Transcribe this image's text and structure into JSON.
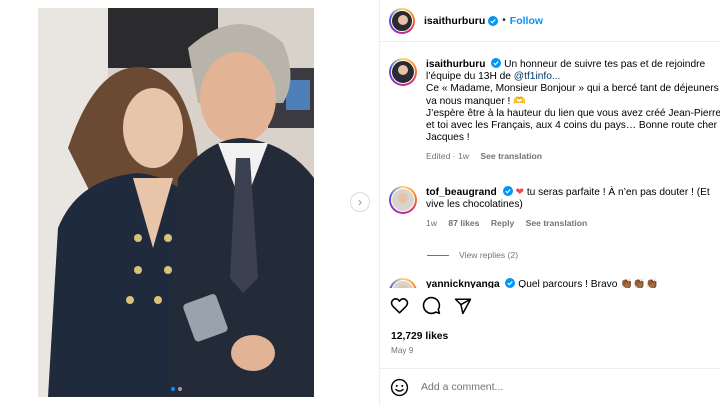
{
  "post": {
    "username": "isaithurburu",
    "follow_label": "Follow",
    "separator": "•",
    "likes": "12,729 likes",
    "date": "May 9",
    "add_comment_placeholder": "Add a comment..."
  },
  "caption": {
    "username": "isaithurburu",
    "text_part1": "Un honneur de suivre tes pas et de rejoindre l’équipe du 13H de ",
    "mention": "@tf1info...",
    "text_part2": "Ce « Madame, Monsieur Bonjour » qui a bercé tant de déjeuners va nous manquer ! 🫶",
    "text_part3": "J’espère être à la hauteur du lien que vous avez créé Jean-Pierre et toi avec les Français, aux 4 coins du pays… Bonne route cher Jacques !",
    "edited": "Edited · 1w",
    "see_translation": "See translation"
  },
  "comments": [
    {
      "username": "tof_beaugrand",
      "text_before": " ",
      "text_after": " tu seras parfaite ! À n’en pas douter ! (Et vive les chocolatines)",
      "time": "1w",
      "likes": "87 likes",
      "reply": "Reply",
      "see_translation": "See translation",
      "view_replies": "View replies (2)"
    },
    {
      "username": "yannicknyanga",
      "text": " Quel parcours ! Bravo 👏🏾👏🏾👏🏾"
    }
  ],
  "icons": {
    "verified": "verified-badge-icon",
    "like": "heart-icon",
    "comment": "comment-icon",
    "share": "share-icon",
    "emoji": "emoji-icon",
    "next": "chevron-right-icon"
  },
  "colors": {
    "accent": "#0095f6",
    "link": "#00376b",
    "heart": "#ed4956",
    "muted": "#737373"
  }
}
